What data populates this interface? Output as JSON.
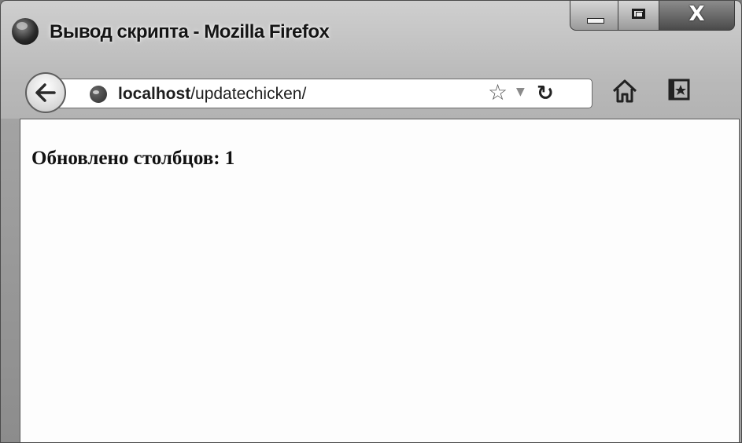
{
  "window": {
    "title": "Вывод скрипта - Mozilla Firefox",
    "controls": {
      "minimize": "",
      "maximize": "",
      "close": "X"
    }
  },
  "navbar": {
    "url_host": "localhost",
    "url_path": "/updatechicken/",
    "icons": [
      "back-arrow-icon",
      "globe-icon",
      "bookmark-star-icon",
      "dropdown-icon",
      "reload-icon",
      "home-icon",
      "bookmarks-menu-icon"
    ]
  },
  "content": {
    "message": "Обновлено столбцов: 1"
  }
}
